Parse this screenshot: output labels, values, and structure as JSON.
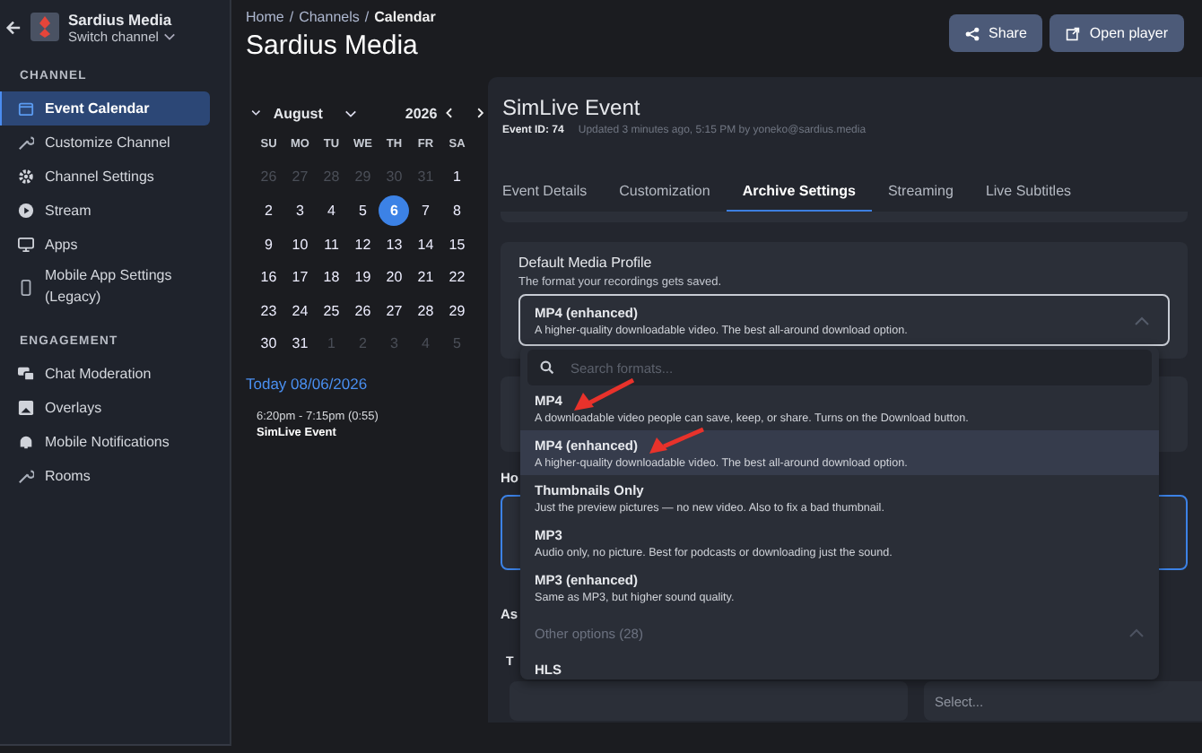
{
  "sidebar": {
    "org_name": "Sardius Media",
    "switch_label": "Switch channel",
    "sections": [
      {
        "heading": "CHANNEL",
        "items": [
          {
            "label": "Event Calendar",
            "selected": true
          },
          {
            "label": "Customize Channel",
            "selected": false
          },
          {
            "label": "Channel Settings",
            "selected": false
          },
          {
            "label": "Stream",
            "selected": false
          },
          {
            "label": "Apps",
            "selected": false
          },
          {
            "label": "Mobile App Settings (Legacy)",
            "selected": false
          }
        ]
      },
      {
        "heading": "ENGAGEMENT",
        "items": [
          {
            "label": "Chat Moderation",
            "selected": false
          },
          {
            "label": "Overlays",
            "selected": false
          },
          {
            "label": "Mobile Notifications",
            "selected": false
          },
          {
            "label": "Rooms",
            "selected": false
          }
        ]
      }
    ]
  },
  "breadcrumb": {
    "separator": "/",
    "items": [
      {
        "label": "Home",
        "current": false
      },
      {
        "label": "Channels",
        "current": false
      },
      {
        "label": "Calendar",
        "current": true
      }
    ]
  },
  "page_title": "Sardius Media",
  "calendar": {
    "month": "August",
    "year": "2026",
    "weekdays": [
      "SU",
      "MO",
      "TU",
      "WE",
      "TH",
      "FR",
      "SA"
    ],
    "weeks": [
      [
        {
          "day": "26",
          "outside": true,
          "selected": false
        },
        {
          "day": "27",
          "outside": true,
          "selected": false
        },
        {
          "day": "28",
          "outside": true,
          "selected": false
        },
        {
          "day": "29",
          "outside": true,
          "selected": false
        },
        {
          "day": "30",
          "outside": true,
          "selected": false
        },
        {
          "day": "31",
          "outside": true,
          "selected": false
        },
        {
          "day": "1",
          "outside": false,
          "selected": false
        }
      ],
      [
        {
          "day": "2",
          "outside": false,
          "selected": false
        },
        {
          "day": "3",
          "outside": false,
          "selected": false
        },
        {
          "day": "4",
          "outside": false,
          "selected": false
        },
        {
          "day": "5",
          "outside": false,
          "selected": false
        },
        {
          "day": "6",
          "outside": false,
          "selected": true
        },
        {
          "day": "7",
          "outside": false,
          "selected": false
        },
        {
          "day": "8",
          "outside": false,
          "selected": false
        }
      ],
      [
        {
          "day": "9",
          "outside": false,
          "selected": false
        },
        {
          "day": "10",
          "outside": false,
          "selected": false
        },
        {
          "day": "11",
          "outside": false,
          "selected": false
        },
        {
          "day": "12",
          "outside": false,
          "selected": false
        },
        {
          "day": "13",
          "outside": false,
          "selected": false
        },
        {
          "day": "14",
          "outside": false,
          "selected": false
        },
        {
          "day": "15",
          "outside": false,
          "selected": false
        }
      ],
      [
        {
          "day": "16",
          "outside": false,
          "selected": false
        },
        {
          "day": "17",
          "outside": false,
          "selected": false
        },
        {
          "day": "18",
          "outside": false,
          "selected": false
        },
        {
          "day": "19",
          "outside": false,
          "selected": false
        },
        {
          "day": "20",
          "outside": false,
          "selected": false
        },
        {
          "day": "21",
          "outside": false,
          "selected": false
        },
        {
          "day": "22",
          "outside": false,
          "selected": false
        }
      ],
      [
        {
          "day": "23",
          "outside": false,
          "selected": false
        },
        {
          "day": "24",
          "outside": false,
          "selected": false
        },
        {
          "day": "25",
          "outside": false,
          "selected": false
        },
        {
          "day": "26",
          "outside": false,
          "selected": false
        },
        {
          "day": "27",
          "outside": false,
          "selected": false
        },
        {
          "day": "28",
          "outside": false,
          "selected": false
        },
        {
          "day": "29",
          "outside": false,
          "selected": false
        }
      ],
      [
        {
          "day": "30",
          "outside": false,
          "selected": false
        },
        {
          "day": "31",
          "outside": false,
          "selected": false
        },
        {
          "day": "1",
          "outside": true,
          "selected": false
        },
        {
          "day": "2",
          "outside": true,
          "selected": false
        },
        {
          "day": "3",
          "outside": true,
          "selected": false
        },
        {
          "day": "4",
          "outside": true,
          "selected": false
        },
        {
          "day": "5",
          "outside": true,
          "selected": false
        }
      ]
    ],
    "today_label": "Today 08/06/2026",
    "events": [
      {
        "time": "6:20pm - 7:15pm (0:55)",
        "title": "SimLive Event"
      }
    ]
  },
  "actions": [
    {
      "label": "Share"
    },
    {
      "label": "Open player"
    }
  ],
  "event": {
    "title": "SimLive Event",
    "id_label": "Event ID: 74",
    "updated": "Updated 3 minutes ago, 5:15 PM by yoneko@sardius.media"
  },
  "tabs": [
    {
      "label": "Event Details",
      "selected": false
    },
    {
      "label": "Customization",
      "selected": false
    },
    {
      "label": "Archive Settings",
      "selected": true
    },
    {
      "label": "Streaming",
      "selected": false
    },
    {
      "label": "Live Subtitles",
      "selected": false
    }
  ],
  "media_profile": {
    "label": "Default Media Profile",
    "hint": "The format your recordings gets saved.",
    "value_title": "MP4 (enhanced)",
    "value_desc": "A higher-quality downloadable video. The best all-around download option.",
    "expanded": true
  },
  "dropdown": {
    "search_placeholder": "Search formats...",
    "options": [
      {
        "title": "MP4",
        "desc": "A downloadable video people can save, keep, or share. Turns on the Download button.",
        "selected": false
      },
      {
        "title": "MP4 (enhanced)",
        "desc": "A higher-quality downloadable video. The best all-around download option.",
        "selected": true
      },
      {
        "title": "Thumbnails Only",
        "desc": "Just the preview pictures — no new video. Also to fix a bad thumbnail.",
        "selected": false
      },
      {
        "title": "MP3",
        "desc": "Audio only, no picture. Best for podcasts or downloading just the sound.",
        "selected": false
      },
      {
        "title": "MP3 (enhanced)",
        "desc": "Same as MP3, but higher sound quality.",
        "selected": false
      }
    ],
    "other_options": {
      "label": "Other options (28)",
      "expanded": true
    },
    "more_options": [
      {
        "title": "HLS"
      }
    ]
  },
  "background": {
    "section_label_1": "Ho",
    "section_label_2": "As",
    "field_label": "T",
    "select_placeholder": "Select..."
  }
}
